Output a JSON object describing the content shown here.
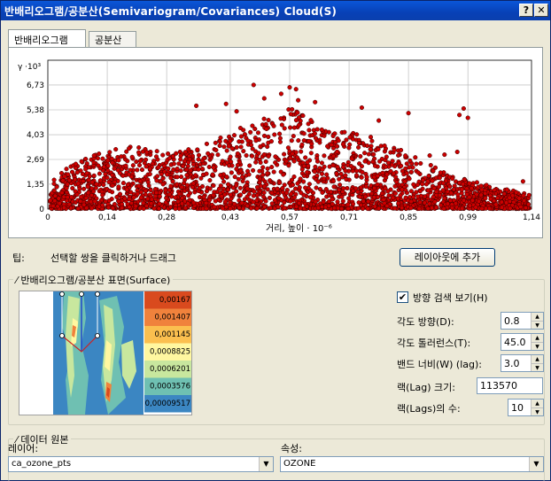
{
  "window": {
    "title": "반배리오그램/공분산(Semivariogram/Covariances)   Cloud(S)",
    "help_button": "?",
    "close_button": "✕"
  },
  "tabs": [
    {
      "label": "반배리오그램",
      "active": true
    },
    {
      "label": "공분산",
      "active": false
    }
  ],
  "chart_data": {
    "type": "scatter",
    "ylabel": "γ ·10³",
    "xlabel": "거리, 높이 · 10⁻⁶",
    "y_ticks": [
      "6,73",
      "5,38",
      "4,03",
      "2,69",
      "1,35",
      "0"
    ],
    "x_ticks": [
      "0",
      "0,14",
      "0,28",
      "0,43",
      "0,57",
      "0,71",
      "0,85",
      "0,99",
      "1,14"
    ],
    "xlim": [
      0,
      1.14
    ],
    "ylim": [
      0,
      8.07
    ],
    "grid": true,
    "point_color": "#cc0000",
    "density_profile": [
      {
        "x": 0.0,
        "ymax": 1.5
      },
      {
        "x": 0.1,
        "ymax": 3.0
      },
      {
        "x": 0.2,
        "ymax": 3.4
      },
      {
        "x": 0.3,
        "ymax": 3.0
      },
      {
        "x": 0.4,
        "ymax": 3.9
      },
      {
        "x": 0.5,
        "ymax": 4.8
      },
      {
        "x": 0.57,
        "ymax": 5.5
      },
      {
        "x": 0.65,
        "ymax": 4.4
      },
      {
        "x": 0.75,
        "ymax": 4.0
      },
      {
        "x": 0.85,
        "ymax": 3.0
      },
      {
        "x": 0.95,
        "ymax": 1.8
      },
      {
        "x": 1.05,
        "ymax": 1.2
      },
      {
        "x": 1.14,
        "ymax": 0.8
      }
    ],
    "outliers": [
      {
        "x": 0.485,
        "y": 6.73
      },
      {
        "x": 0.57,
        "y": 6.6
      },
      {
        "x": 0.585,
        "y": 6.5
      },
      {
        "x": 0.55,
        "y": 6.25
      },
      {
        "x": 0.51,
        "y": 6.0
      },
      {
        "x": 0.59,
        "y": 5.9
      },
      {
        "x": 0.42,
        "y": 5.7
      },
      {
        "x": 0.35,
        "y": 5.6
      },
      {
        "x": 0.445,
        "y": 5.3
      },
      {
        "x": 0.63,
        "y": 5.8
      },
      {
        "x": 0.74,
        "y": 5.5
      },
      {
        "x": 0.78,
        "y": 4.8
      },
      {
        "x": 0.85,
        "y": 5.2
      },
      {
        "x": 0.98,
        "y": 5.45
      },
      {
        "x": 0.97,
        "y": 5.1
      },
      {
        "x": 0.99,
        "y": 4.95
      },
      {
        "x": 0.965,
        "y": 3.1
      },
      {
        "x": 1.12,
        "y": 1.5
      },
      {
        "x": 0.935,
        "y": 2.95
      },
      {
        "x": 0.9,
        "y": 2.9
      },
      {
        "x": 1.06,
        "y": 0.6
      }
    ]
  },
  "tip": {
    "label": "팁:",
    "text": "선택할 쌍을 클릭하거나 드래그",
    "add_layout_button": "레이아웃에 추가"
  },
  "surface_group": {
    "title": "반배리오그램/공분산 표면(Surface)",
    "legend": [
      {
        "label": "0,00167",
        "color": "#d94a1e"
      },
      {
        "label": "0,001407",
        "color": "#f0823c"
      },
      {
        "label": "0,001145",
        "color": "#fbbf4f"
      },
      {
        "label": "0,0008825",
        "color": "#fff7a0"
      },
      {
        "label": "0,0006201",
        "color": "#c8e79e"
      },
      {
        "label": "0,0003576",
        "color": "#6fc0b2"
      },
      {
        "label": "0,00009517",
        "color": "#3b86c2"
      }
    ],
    "direction_search_label": "방향 검색 보기(H)",
    "direction_search_checked": true,
    "params": [
      {
        "label": "각도 방향(D):",
        "value": "0.8"
      },
      {
        "label": "각도 톨러런스(T):",
        "value": "45.0"
      },
      {
        "label": "밴드 너비(W) (lag):",
        "value": "3.0"
      }
    ],
    "lag_size_label": "랙(Lag) 크기:",
    "lag_size_value": "113570",
    "lags_count_label": "랙(Lags)의 수:",
    "lags_count_value": "10"
  },
  "data_group": {
    "title": "데이터 원본",
    "layer_label": "레이어:",
    "layer_value": "ca_ozone_pts",
    "attribute_label": "속성:",
    "attribute_value": "OZONE"
  }
}
